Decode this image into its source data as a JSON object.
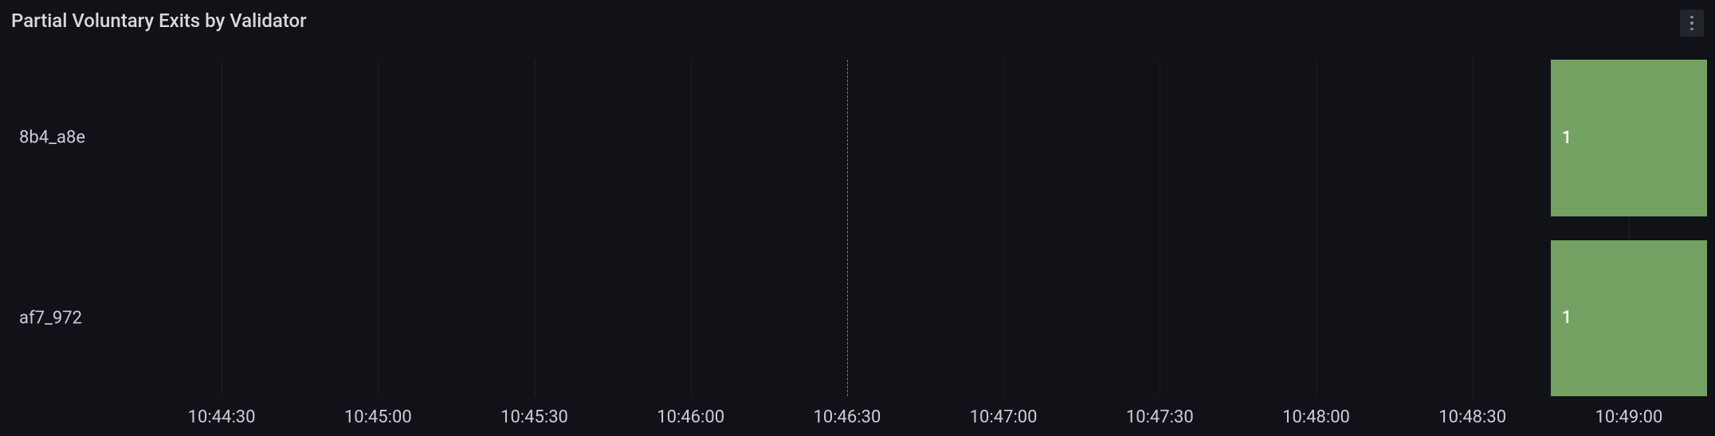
{
  "panel": {
    "title": "Partial Voluntary Exits by Validator"
  },
  "chart_data": {
    "type": "heatmap",
    "title": "Partial Voluntary Exits by Validator",
    "xlabel": "",
    "ylabel": "",
    "y_categories": [
      "8b4_a8e",
      "af7_972"
    ],
    "x_ticks": [
      "10:44:30",
      "10:45:00",
      "10:45:30",
      "10:46:00",
      "10:46:30",
      "10:47:00",
      "10:47:30",
      "10:48:00",
      "10:48:30",
      "10:49:00"
    ],
    "x_range_seconds": [
      38655,
      38955
    ],
    "cursor_x_seconds": 38790,
    "cells": [
      {
        "y": "8b4_a8e",
        "x_start_seconds": 38925,
        "x_end_seconds": 38955,
        "value": 1
      },
      {
        "y": "af7_972",
        "x_start_seconds": 38925,
        "x_end_seconds": 38955,
        "value": 1
      }
    ],
    "colors": {
      "cell_fill": "#73a263",
      "cell_text": "#ffffff"
    }
  }
}
